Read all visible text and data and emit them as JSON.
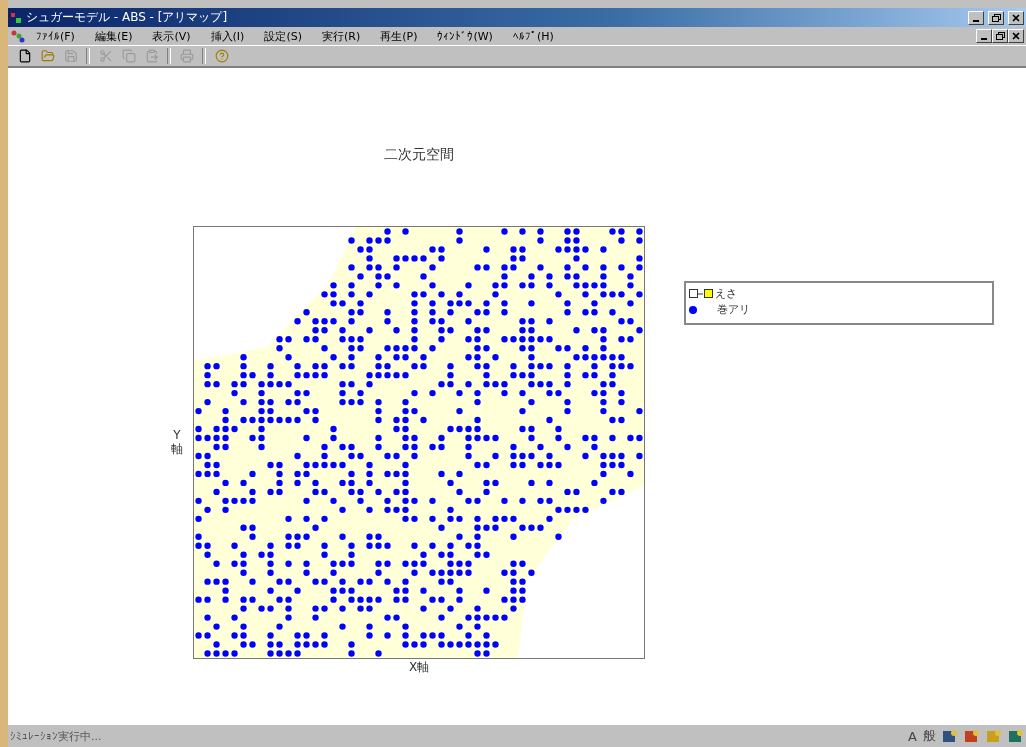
{
  "window": {
    "title": "シュガーモデル - ABS - [アリマップ]"
  },
  "menu": [
    "ﾌｧｲﾙ(F)",
    "編集(E)",
    "表示(V)",
    "挿入(I)",
    "設定(S)",
    "実行(R)",
    "再生(P)",
    "ｳｨﾝﾄﾞｳ(W)",
    "ﾍﾙﾌﾟ(H)"
  ],
  "toolbar": [
    {
      "kind": "new",
      "disabled": false
    },
    {
      "kind": "open",
      "disabled": false
    },
    {
      "kind": "save",
      "disabled": true
    },
    {
      "kind": "separator"
    },
    {
      "kind": "cut",
      "disabled": true
    },
    {
      "kind": "copy",
      "disabled": true
    },
    {
      "kind": "paste",
      "disabled": true
    },
    {
      "kind": "separator"
    },
    {
      "kind": "print",
      "disabled": true
    },
    {
      "kind": "separator"
    },
    {
      "kind": "help",
      "disabled": false
    }
  ],
  "chart": {
    "title": "二次元空間",
    "ylabel_top": "Y",
    "ylabel_bottom": "軸",
    "xlabel": "X軸"
  },
  "legend": [
    {
      "kind": "square",
      "label": "えさ",
      "color": "#ffff00"
    },
    {
      "kind": "dot",
      "label": "巻アリ",
      "color": "#0000ff"
    }
  ],
  "status_bar": {
    "text": "ｼﾐｭﾚｰｼｮﾝ実行中..."
  },
  "tray": [
    {
      "kind": "text",
      "label": "A"
    },
    {
      "kind": "text",
      "label": "般"
    },
    {
      "kind": "icon"
    },
    {
      "kind": "icon"
    },
    {
      "kind": "icon"
    },
    {
      "kind": "icon"
    }
  ]
}
